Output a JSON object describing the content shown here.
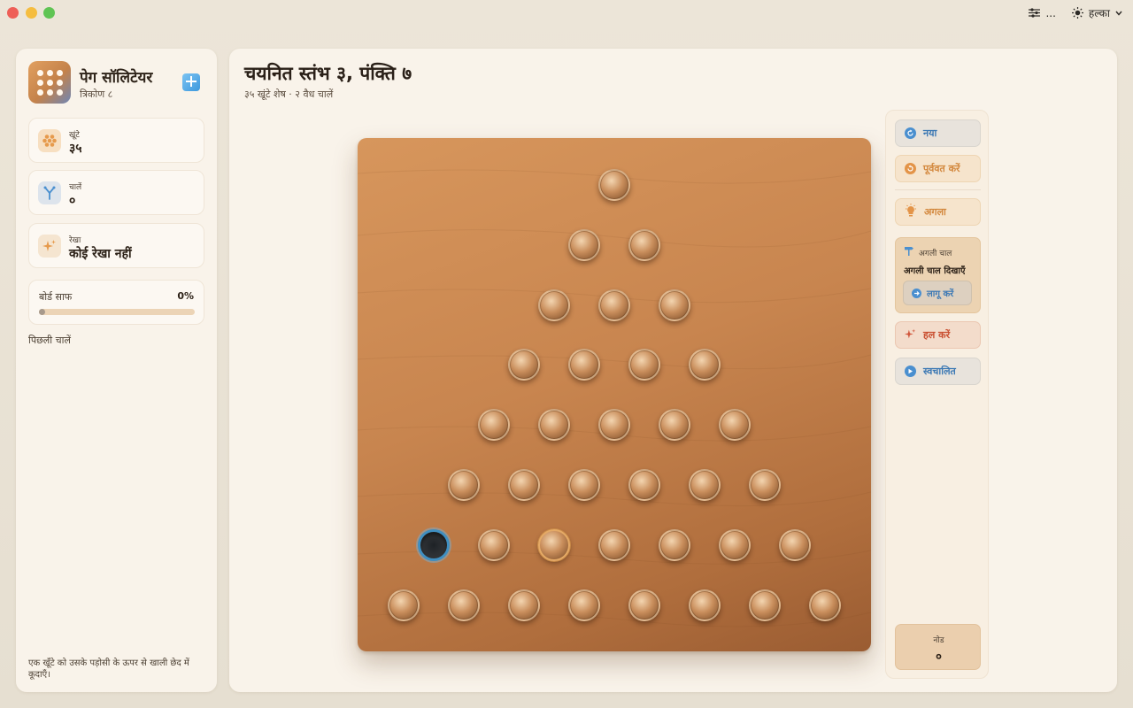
{
  "titlebar": {
    "settings_label": "...",
    "theme_label": "हल्का"
  },
  "sidebar": {
    "app_title": "पेग सॉलिटेयर",
    "app_subtitle": "त्रिकोण ८",
    "stats": [
      {
        "label": "खूंटे",
        "value": "३५",
        "icon": "pegs-icon",
        "color": "#e69a4c"
      },
      {
        "label": "चालें",
        "value": "०",
        "icon": "moves-icon",
        "color": "#4a8fcf"
      },
      {
        "label": "रेखा",
        "value": "कोई रेखा नहीं",
        "icon": "sparkle-icon",
        "color": "#e69a4c"
      }
    ],
    "progress": {
      "label": "बोर्ड साफ",
      "value_label": "0%",
      "fraction": 0
    },
    "history_label": "पिछली चालें",
    "hint": "एक खूँटे को उसके पड़ोसी के ऊपर से खाली छेद में कूदाएँ।"
  },
  "main": {
    "title": "चयनित स्तंभ ३, पंक्ति ७",
    "subtitle": "३५ खूंटे शेष · २ वैध चालें"
  },
  "board": {
    "rows": 8,
    "empty": [
      {
        "row": 7,
        "col": 1
      }
    ],
    "selected": {
      "row": 7,
      "col": 3
    }
  },
  "panel": {
    "new_label": "नया",
    "undo_label": "पूर्ववत करें",
    "next_label": "अगला",
    "next_card_title": "अगली चाल",
    "next_card_text": "अगली चाल दिखाएँ",
    "apply_label": "लागू करें",
    "solve_label": "हल करें",
    "auto_label": "स्वचालित",
    "node_label": "नोड",
    "node_value": "०"
  },
  "colors": {
    "accent_blue": "#3b78b4",
    "accent_orange": "#d3883e",
    "accent_red": "#c94e2f",
    "board_wood": "#c8854f",
    "empty_ring": "#3f8fc2"
  }
}
